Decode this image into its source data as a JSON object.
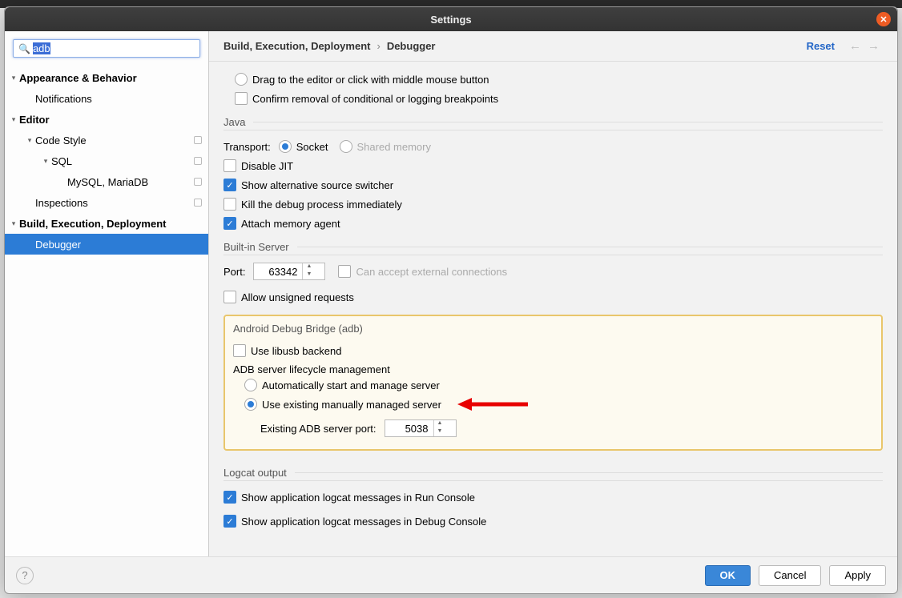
{
  "title": "Settings",
  "search": {
    "value": "adb"
  },
  "tree": [
    {
      "label": "Appearance & Behavior",
      "depth": 0,
      "bold": true,
      "chevron": true,
      "badge": false
    },
    {
      "label": "Notifications",
      "depth": 1,
      "bold": false,
      "chevron": false,
      "badge": false
    },
    {
      "label": "Editor",
      "depth": 0,
      "bold": true,
      "chevron": true,
      "badge": false
    },
    {
      "label": "Code Style",
      "depth": 1,
      "bold": false,
      "chevron": true,
      "badge": true
    },
    {
      "label": "SQL",
      "depth": 2,
      "bold": false,
      "chevron": true,
      "badge": true
    },
    {
      "label": "MySQL, MariaDB",
      "depth": 3,
      "bold": false,
      "chevron": false,
      "badge": true
    },
    {
      "label": "Inspections",
      "depth": 1,
      "bold": false,
      "chevron": false,
      "badge": true
    },
    {
      "label": "Build, Execution, Deployment",
      "depth": 0,
      "bold": true,
      "chevron": true,
      "badge": false
    },
    {
      "label": "Debugger",
      "depth": 1,
      "bold": false,
      "chevron": false,
      "badge": false,
      "selected": true
    }
  ],
  "breadcrumb": {
    "a": "Build, Execution, Deployment",
    "b": "Debugger",
    "reset": "Reset"
  },
  "top": {
    "drag": "Drag to the editor or click with middle mouse button",
    "confirm": "Confirm removal of conditional or logging breakpoints"
  },
  "java": {
    "title": "Java",
    "transport_label": "Transport:",
    "socket": "Socket",
    "shared": "Shared memory",
    "disable_jit": "Disable JIT",
    "alt_src": "Show alternative source switcher",
    "kill": "Kill the debug process immediately",
    "attach": "Attach memory agent"
  },
  "server": {
    "title": "Built-in Server",
    "port_label": "Port:",
    "port_value": "63342",
    "can_accept": "Can accept external connections",
    "allow_unsigned": "Allow unsigned requests"
  },
  "adb": {
    "title": "Android Debug Bridge (adb)",
    "libusb": "Use libusb backend",
    "lifecycle_title": "ADB server lifecycle management",
    "auto": "Automatically start and manage server",
    "existing": "Use existing manually managed server",
    "port_label": "Existing ADB server port:",
    "port_value": "5038"
  },
  "logcat": {
    "title": "Logcat output",
    "run": "Show application logcat messages in Run Console",
    "debug": "Show application logcat messages in Debug Console"
  },
  "buttons": {
    "ok": "OK",
    "cancel": "Cancel",
    "apply": "Apply"
  }
}
